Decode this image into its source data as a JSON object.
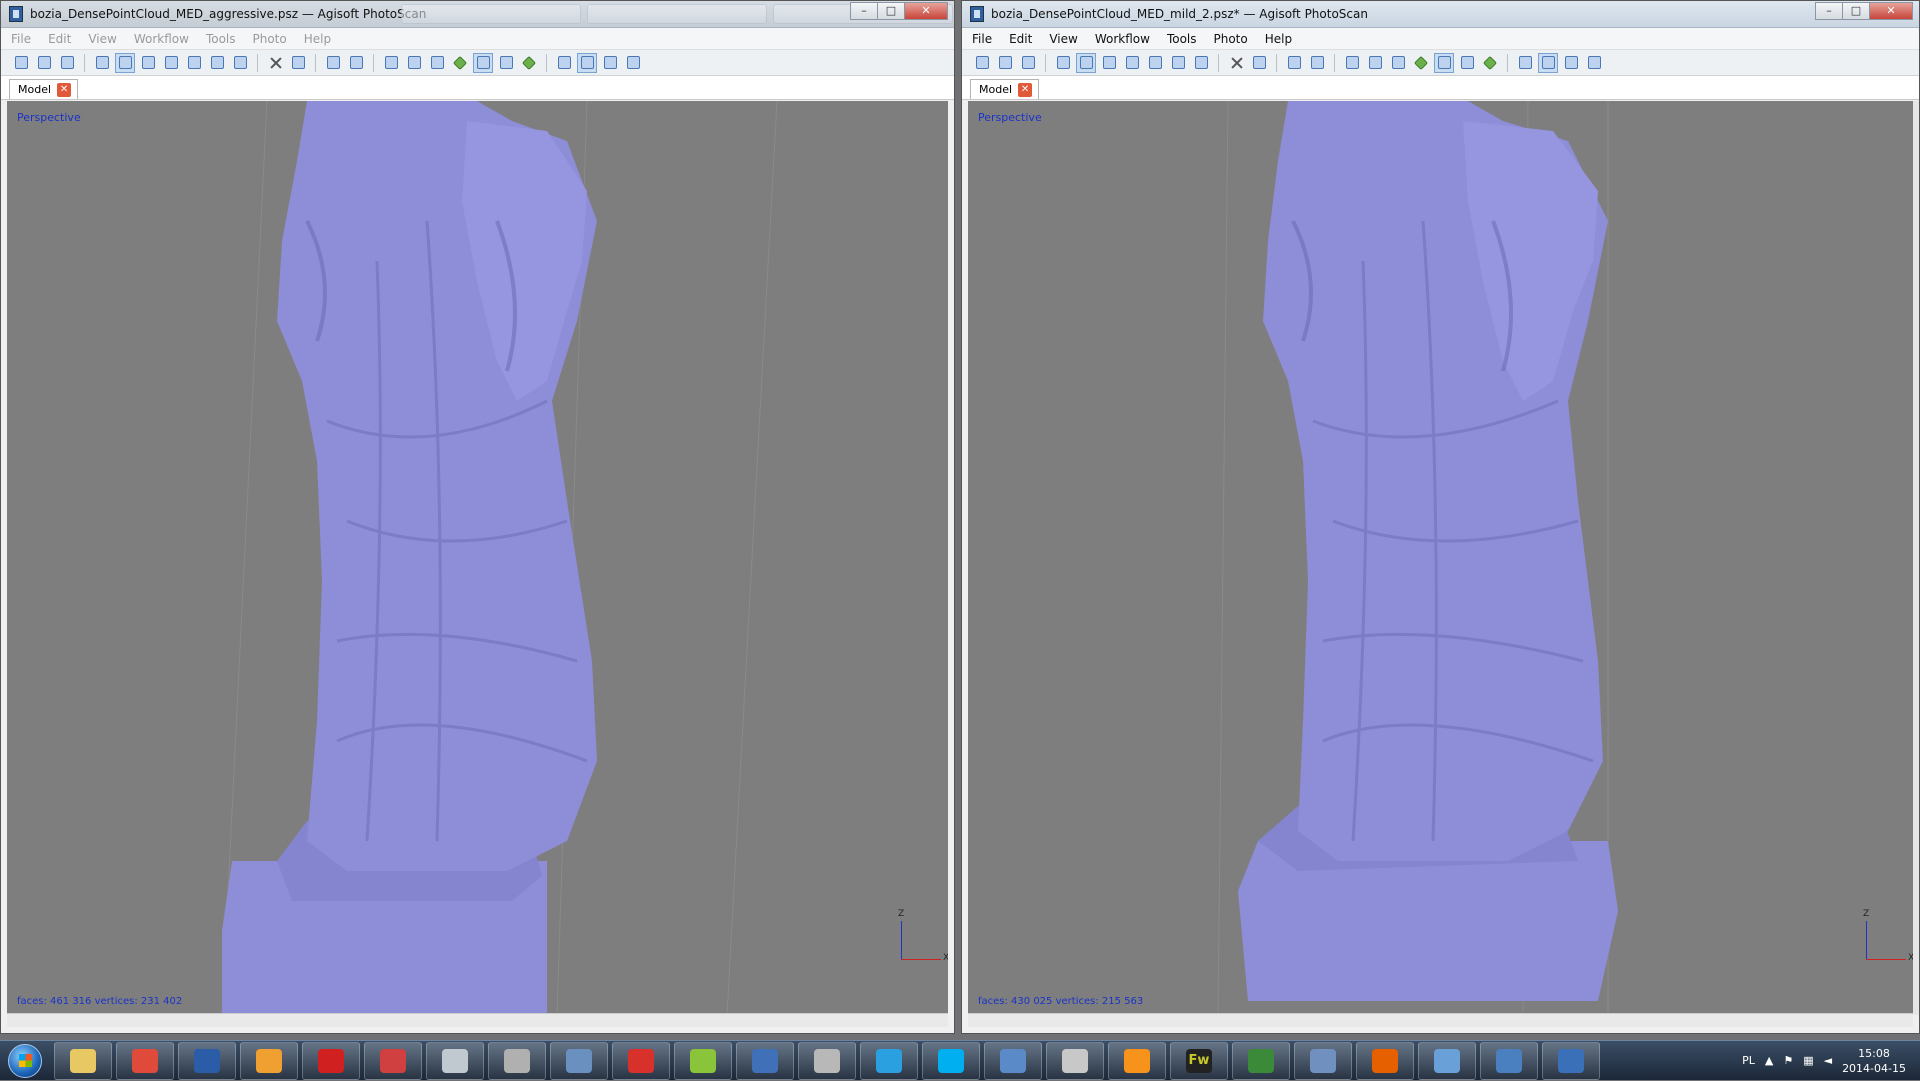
{
  "left_window": {
    "title": "bozia_DensePointCloud_MED_aggressive.psz — Agisoft PhotoScan",
    "menu": [
      "File",
      "Edit",
      "View",
      "Workflow",
      "Tools",
      "Photo",
      "Help"
    ],
    "tab_label": "Model",
    "view_label": "Perspective",
    "stats": "faces: 461 316 vertices: 231 402",
    "axis_z": "Z",
    "axis_x": "X"
  },
  "right_window": {
    "title": "bozia_DensePointCloud_MED_mild_2.psz* — Agisoft PhotoScan",
    "menu": [
      "File",
      "Edit",
      "View",
      "Workflow",
      "Tools",
      "Photo",
      "Help"
    ],
    "tab_label": "Model",
    "view_label": "Perspective",
    "stats": "faces: 430 025 vertices: 215 563",
    "axis_z": "Z",
    "axis_x": "X"
  },
  "window_controls": {
    "minimize": "–",
    "maximize": "□",
    "close": "✕"
  },
  "colors": {
    "model": "#8d8dd8",
    "viewport": "#7e7e7e",
    "label_blue": "#1a33c9"
  },
  "taskbar": {
    "items": [
      {
        "name": "explorer",
        "color": "#e8c862"
      },
      {
        "name": "chrome",
        "color": "#e04a3a"
      },
      {
        "name": "save-app",
        "color": "#2a5ca8"
      },
      {
        "name": "tool-app",
        "color": "#f0a030"
      },
      {
        "name": "pdf-app",
        "color": "#d02020"
      },
      {
        "name": "mail-app",
        "color": "#d04040"
      },
      {
        "name": "box-app",
        "color": "#c0c8d0"
      },
      {
        "name": "snipping-app",
        "color": "#b0b0b0"
      },
      {
        "name": "calculator-app",
        "color": "#6a90c0"
      },
      {
        "name": "sketchup-app",
        "color": "#d8302a"
      },
      {
        "name": "android-app",
        "color": "#8ac43a"
      },
      {
        "name": "remote-app",
        "color": "#4070b8"
      },
      {
        "name": "disk-app",
        "color": "#b8b8b8"
      },
      {
        "name": "webstorm-app",
        "color": "#2aa0e0"
      },
      {
        "name": "skype-app",
        "color": "#00aff0"
      },
      {
        "name": "window-app",
        "color": "#5a8ac8"
      },
      {
        "name": "scanner-app",
        "color": "#c8c8c8"
      },
      {
        "name": "bitcoin-app",
        "color": "#f7931a"
      },
      {
        "name": "fireworks-app",
        "color": "#c8c828"
      },
      {
        "name": "terminal-app",
        "color": "#3a8a3a"
      },
      {
        "name": "book-app",
        "color": "#7090c0"
      },
      {
        "name": "firefox-app",
        "color": "#e66000"
      },
      {
        "name": "network-app",
        "color": "#6aa0d8"
      },
      {
        "name": "photoscan-a",
        "color": "#4a80c0"
      },
      {
        "name": "photoscan-b",
        "color": "#3a70b8"
      }
    ],
    "fireworks_label": "Fw",
    "lang": "PL",
    "time": "15:08",
    "date": "2014-04-15"
  }
}
